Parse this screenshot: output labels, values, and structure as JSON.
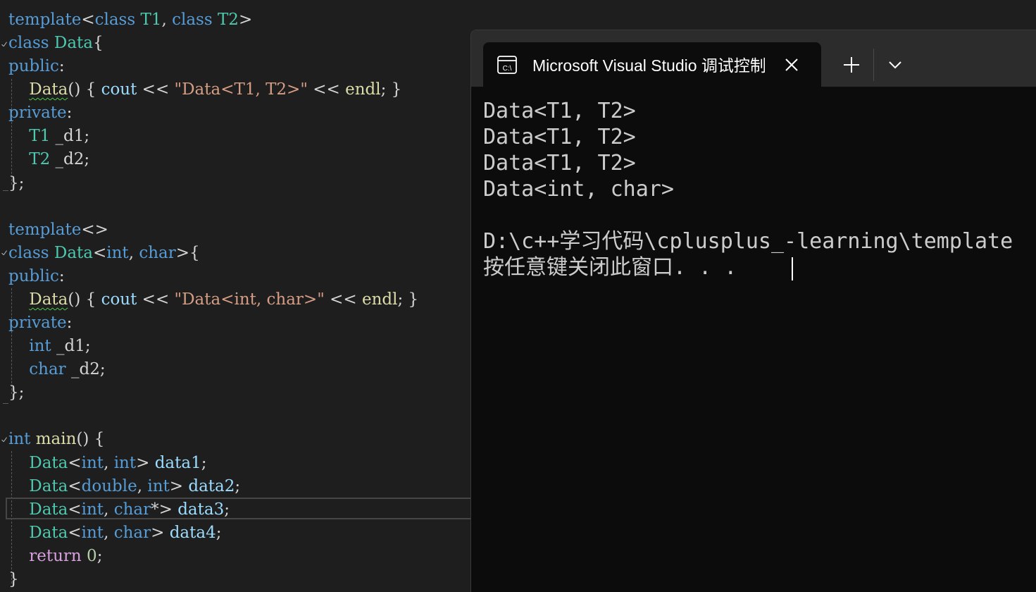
{
  "editor": {
    "lines": [
      [
        [
          "kw",
          "template"
        ],
        [
          "pl",
          "<"
        ],
        [
          "kw",
          "class"
        ],
        [
          "pl",
          " "
        ],
        [
          "ty",
          "T1"
        ],
        [
          "pl",
          ", "
        ],
        [
          "kw",
          "class"
        ],
        [
          "pl",
          " "
        ],
        [
          "ty",
          "T2"
        ],
        [
          "pl",
          ">"
        ]
      ],
      [
        [
          "kw",
          "class"
        ],
        [
          "pl",
          " "
        ],
        [
          "ty",
          "Data"
        ],
        [
          "pl",
          "{"
        ]
      ],
      [
        [
          "kw",
          "public"
        ],
        [
          "pl",
          ":"
        ]
      ],
      [
        [
          "pl",
          "    "
        ],
        [
          "fn squig",
          "Data"
        ],
        [
          "pl",
          "() { "
        ],
        [
          "vr",
          "cout"
        ],
        [
          "pl",
          " << "
        ],
        [
          "st",
          "\"Data<T1, T2>\""
        ],
        [
          "pl",
          " << "
        ],
        [
          "fn",
          "endl"
        ],
        [
          "pl",
          "; }"
        ]
      ],
      [
        [
          "kw",
          "private"
        ],
        [
          "pl",
          ":"
        ]
      ],
      [
        [
          "pl",
          "    "
        ],
        [
          "ty",
          "T1"
        ],
        [
          "pl",
          " "
        ],
        [
          "pl",
          "_d1;"
        ]
      ],
      [
        [
          "pl",
          "    "
        ],
        [
          "ty",
          "T2"
        ],
        [
          "pl",
          " "
        ],
        [
          "pl",
          "_d2;"
        ]
      ],
      [
        [
          "pl",
          "};"
        ]
      ],
      [
        [
          "pl",
          ""
        ]
      ],
      [
        [
          "kw",
          "template"
        ],
        [
          "pl",
          "<>"
        ]
      ],
      [
        [
          "kw",
          "class"
        ],
        [
          "pl",
          " "
        ],
        [
          "ty",
          "Data"
        ],
        [
          "pl",
          "<"
        ],
        [
          "kw",
          "int"
        ],
        [
          "pl",
          ", "
        ],
        [
          "kw",
          "char"
        ],
        [
          "pl",
          ">{"
        ]
      ],
      [
        [
          "kw",
          "public"
        ],
        [
          "pl",
          ":"
        ]
      ],
      [
        [
          "pl",
          "    "
        ],
        [
          "fn squig",
          "Data"
        ],
        [
          "pl",
          "() { "
        ],
        [
          "vr",
          "cout"
        ],
        [
          "pl",
          " << "
        ],
        [
          "st",
          "\"Data<int, char>\""
        ],
        [
          "pl",
          " << "
        ],
        [
          "fn",
          "endl"
        ],
        [
          "pl",
          "; }"
        ]
      ],
      [
        [
          "kw",
          "private"
        ],
        [
          "pl",
          ":"
        ]
      ],
      [
        [
          "pl",
          "    "
        ],
        [
          "kw",
          "int"
        ],
        [
          "pl",
          " "
        ],
        [
          "pl",
          "_d1;"
        ]
      ],
      [
        [
          "pl",
          "    "
        ],
        [
          "kw",
          "char"
        ],
        [
          "pl",
          " "
        ],
        [
          "pl",
          "_d2;"
        ]
      ],
      [
        [
          "pl",
          "};"
        ]
      ],
      [
        [
          "pl",
          ""
        ]
      ],
      [
        [
          "kw",
          "int"
        ],
        [
          "pl",
          " "
        ],
        [
          "fn",
          "main"
        ],
        [
          "pl",
          "() {"
        ]
      ],
      [
        [
          "pl",
          "    "
        ],
        [
          "ty",
          "Data"
        ],
        [
          "pl",
          "<"
        ],
        [
          "kw",
          "int"
        ],
        [
          "pl",
          ", "
        ],
        [
          "kw",
          "int"
        ],
        [
          "pl",
          "> "
        ],
        [
          "vr",
          "data1"
        ],
        [
          "pl",
          ";"
        ]
      ],
      [
        [
          "pl",
          "    "
        ],
        [
          "ty",
          "Data"
        ],
        [
          "pl",
          "<"
        ],
        [
          "kw",
          "double"
        ],
        [
          "pl",
          ", "
        ],
        [
          "kw",
          "int"
        ],
        [
          "pl",
          "> "
        ],
        [
          "vr",
          "data2"
        ],
        [
          "pl",
          ";"
        ]
      ],
      [
        [
          "pl",
          "    "
        ],
        [
          "ty",
          "Data"
        ],
        [
          "pl",
          "<"
        ],
        [
          "kw",
          "int"
        ],
        [
          "pl",
          ", "
        ],
        [
          "kw",
          "char"
        ],
        [
          "pl",
          "*> "
        ],
        [
          "vr",
          "data3"
        ],
        [
          "pl",
          ";"
        ]
      ],
      [
        [
          "pl",
          "    "
        ],
        [
          "ty",
          "Data"
        ],
        [
          "pl",
          "<"
        ],
        [
          "kw",
          "int"
        ],
        [
          "pl",
          ", "
        ],
        [
          "kw",
          "char"
        ],
        [
          "pl",
          "> "
        ],
        [
          "vr",
          "data4"
        ],
        [
          "pl",
          ";"
        ]
      ],
      [
        [
          "pl",
          "    "
        ],
        [
          "ctl",
          "return"
        ],
        [
          "pl",
          " "
        ],
        [
          "nm",
          "0"
        ],
        [
          "pl",
          ";"
        ]
      ],
      [
        [
          "pl",
          "}"
        ]
      ]
    ]
  },
  "terminal": {
    "tab_title": "Microsoft Visual Studio 调试控制台",
    "tab_icon": "console-app-icon",
    "output": [
      "Data<T1, T2>",
      "Data<T1, T2>",
      "Data<T1, T2>",
      "Data<int, char>",
      "",
      "D:\\c++学习代码\\cplusplus_-learning\\template",
      "按任意键关闭此窗口. . ."
    ]
  }
}
